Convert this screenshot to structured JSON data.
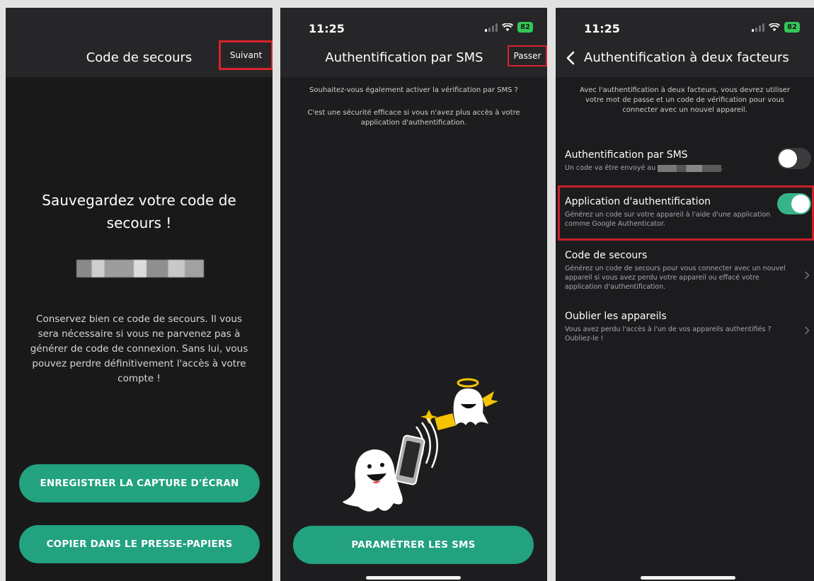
{
  "status": {
    "time": "11:25",
    "battery": "82"
  },
  "screen1": {
    "title": "Code de secours",
    "next_label": "Suivant",
    "heading": "Sauvegardez votre code de secours !",
    "body": "Conservez bien ce code de secours. Il vous sera nécessaire si vous ne parvenez pas à générer de code de connexion. Sans lui, vous pouvez perdre définitivement l'accès à votre compte !",
    "save_button": "ENREGISTRER LA CAPTURE D'ÉCRAN",
    "copy_button": "COPIER DANS LE PRESSE-PAPIERS"
  },
  "screen2": {
    "title": "Authentification par SMS",
    "skip_label": "Passer",
    "question": "Souhaitez-vous également activer la vérification par SMS ?",
    "description": "C'est une sécurité efficace si vous n'avez plus accès à votre application d'authentification.",
    "sms_button": "PARAMÉTRER LES SMS"
  },
  "screen3": {
    "title": "Authentification à deux facteurs",
    "intro": "Avec l'authentification à deux facteurs, vous devrez utiliser votre mot de passe et un code de vérification pour vous connecter avec un nouvel appareil.",
    "settings": [
      {
        "title": "Authentification par SMS",
        "desc": "Un code va être envoyé au",
        "toggle": "off"
      },
      {
        "title": "Application d'authentification",
        "desc": "Générez un code sur votre appareil à l'aide d'une application comme Google Authenticator.",
        "toggle": "on"
      },
      {
        "title": "Code de secours",
        "desc": "Générez un code de secours pour vous connecter avec un nouvel appareil si vous avez perdu votre appareil ou effacé votre application d'authentification."
      },
      {
        "title": "Oublier les appareils",
        "desc": "Vous avez perdu l'accès à l'un de vos appareils authentifiés ? Oubliez-le !"
      }
    ]
  },
  "colors": {
    "accent": "#22a27f",
    "toggle_on": "#37b38a",
    "highlight": "#d9232a",
    "background": "#1c1c1e"
  }
}
